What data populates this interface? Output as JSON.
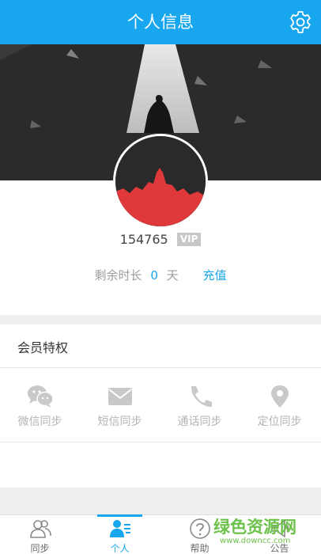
{
  "header": {
    "title": "个人信息",
    "settings_icon": "gear-icon"
  },
  "profile": {
    "user_id": "154765",
    "vip_badge": "VIP",
    "remaining_label": "剩余时长",
    "remaining_value": "0",
    "remaining_unit": "天",
    "recharge_label": "充值"
  },
  "privileges": {
    "title": "会员特权",
    "items": [
      {
        "label": "微信同步",
        "icon": "wechat-icon"
      },
      {
        "label": "短信同步",
        "icon": "envelope-icon"
      },
      {
        "label": "通话同步",
        "icon": "phone-icon"
      },
      {
        "label": "定位同步",
        "icon": "location-pin-icon"
      }
    ]
  },
  "tabbar": {
    "items": [
      {
        "label": "同步",
        "icon": "users-icon"
      },
      {
        "label": "个人",
        "icon": "profile-card-icon",
        "active": true
      },
      {
        "label": "帮助",
        "icon": "question-icon"
      },
      {
        "label": "公告",
        "icon": "announcement-icon"
      }
    ]
  },
  "watermark": {
    "title": "绿色资源网",
    "url": "www.downcc.com"
  },
  "colors": {
    "accent": "#18a7ee",
    "banner": "#2b2b2b",
    "avatar_red": "#e0393b",
    "muted": "#b4b4b4",
    "watermark": "#6cc24a"
  }
}
